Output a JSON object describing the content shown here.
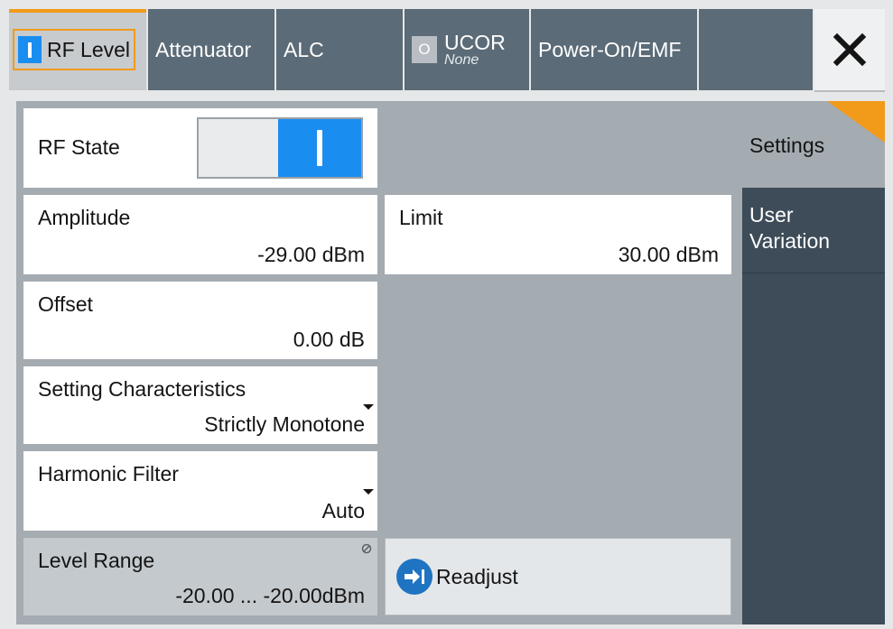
{
  "tabs": {
    "rf_level": "RF Level",
    "attenuator": "Attenuator",
    "alc": "ALC",
    "ucor": "UCOR",
    "ucor_sub": "None",
    "ucor_state": "O",
    "power_on_emf": "Power-On/EMF"
  },
  "close_icon": "close-icon",
  "fields": {
    "rf_state": {
      "label": "RF State",
      "state": "on"
    },
    "amplitude": {
      "label": "Amplitude",
      "value": "-29.00 dBm"
    },
    "limit": {
      "label": "Limit",
      "value": "30.00 dBm"
    },
    "offset": {
      "label": "Offset",
      "value": "0.00 dB"
    },
    "setting_characteristics": {
      "label": "Setting Characteristics",
      "value": "Strictly Monotone"
    },
    "harmonic_filter": {
      "label": "Harmonic Filter",
      "value": "Auto"
    },
    "level_range": {
      "label": "Level Range",
      "value": "-20.00 ... -20.00dBm"
    }
  },
  "readjust": {
    "label": "Readjust",
    "icon": "arrow-right-icon"
  },
  "sidenav": {
    "settings": "Settings",
    "user_variation_line1": "User",
    "user_variation_line2": "Variation"
  },
  "colors": {
    "accent": "#f29a1a",
    "on_blue": "#1a8df0",
    "tab_bg": "#5b6b77",
    "nav_dark": "#3d4c58"
  }
}
